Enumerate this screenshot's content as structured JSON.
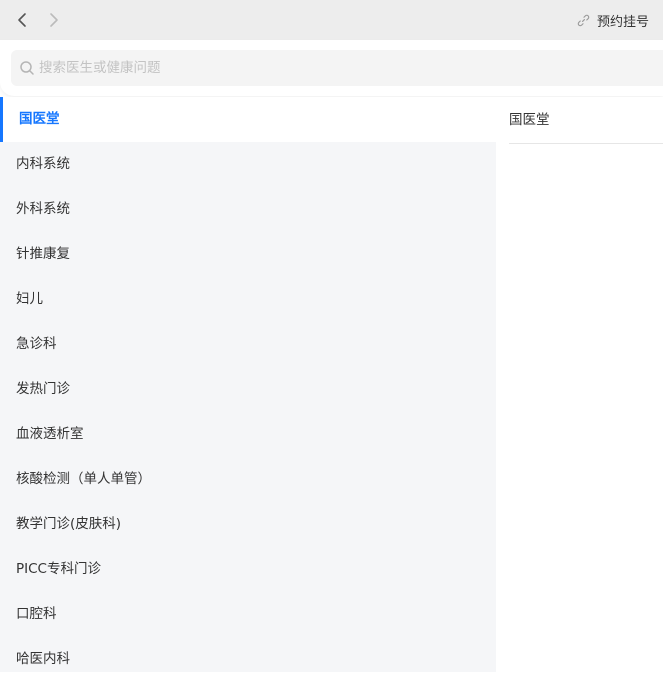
{
  "topbar": {
    "back_icon": "chevron-left-icon",
    "forward_icon": "chevron-right-icon",
    "appointment_label": "预约挂号",
    "appointment_icon": "link-icon"
  },
  "search": {
    "placeholder": "搜索医生或健康问题",
    "value": "",
    "icon": "search-icon"
  },
  "sidebar": {
    "active_index": 0,
    "accent_color": "#1677ff",
    "items": [
      {
        "label": "国医堂"
      },
      {
        "label": "内科系统"
      },
      {
        "label": "外科系统"
      },
      {
        "label": "针推康复"
      },
      {
        "label": "妇儿"
      },
      {
        "label": "急诊科"
      },
      {
        "label": "发热门诊"
      },
      {
        "label": "血液透析室"
      },
      {
        "label": "核酸检测（单人单管）"
      },
      {
        "label": "教学门诊(皮肤科)"
      },
      {
        "label": "PICC专科门诊"
      },
      {
        "label": "口腔科"
      },
      {
        "label": "哈医内科"
      }
    ]
  },
  "content": {
    "header": "国医堂"
  }
}
